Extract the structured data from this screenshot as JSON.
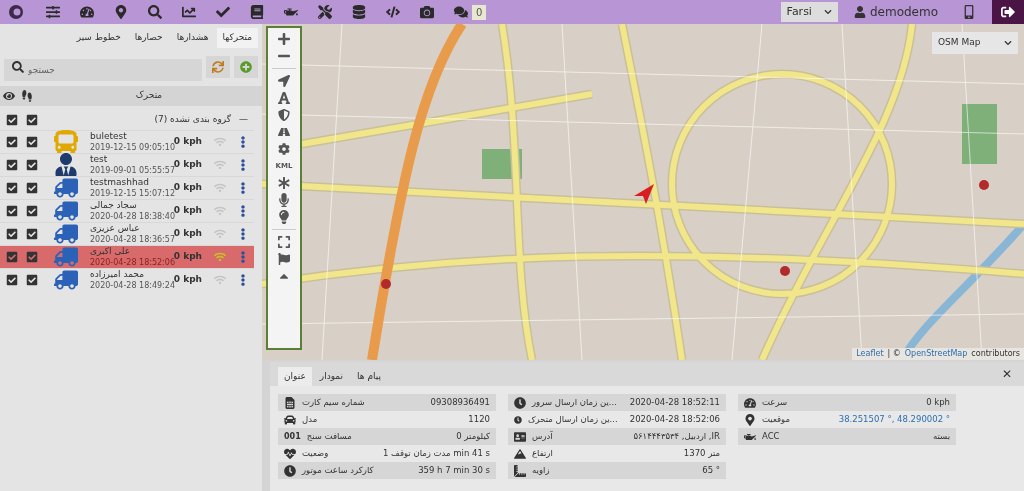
{
  "top_bar": {
    "badge": "0",
    "language": "Farsi",
    "user": "demodemo"
  },
  "sidebar": {
    "tabs": [
      {
        "label": "متحرکها",
        "selected": true
      },
      {
        "label": "هشدارها",
        "selected": false
      },
      {
        "label": "حصارها",
        "selected": false
      },
      {
        "label": "خطوط سیر",
        "selected": false
      }
    ],
    "search": {
      "placeholder": "جستجو"
    },
    "table_header": "متحرک",
    "group": {
      "label": "(7) گروه بندی نشده",
      "collapse": "—",
      "visible": true,
      "tail": true
    },
    "devices": [
      {
        "name": "buletest",
        "time": "2019-12-15 09:05:10",
        "speed": "0 kph",
        "kind": "bus",
        "visible": true,
        "tail": true,
        "selected": false,
        "online": false
      },
      {
        "name": "test",
        "time": "2019-09-01 05:55:57",
        "speed": "0 kph",
        "kind": "person",
        "visible": true,
        "tail": true,
        "selected": false,
        "online": false
      },
      {
        "name": "testmashhad",
        "time": "2019-12-15 15:07:12",
        "speed": "0 kph",
        "kind": "truck",
        "visible": true,
        "tail": true,
        "selected": false,
        "online": false
      },
      {
        "name": "سجاد جمالی",
        "time": "2020-04-28 18:38:40",
        "speed": "0 kph",
        "kind": "truck",
        "visible": true,
        "tail": true,
        "selected": false,
        "online": false
      },
      {
        "name": "عباس عزیزی",
        "time": "2020-04-28 18:36:57",
        "speed": "0 kph",
        "kind": "truck",
        "visible": true,
        "tail": true,
        "selected": false,
        "online": false
      },
      {
        "name": "علی اکبری",
        "time": "2020-04-28 18:52:06",
        "speed": "0 kph",
        "kind": "truck",
        "visible": true,
        "tail": true,
        "selected": true,
        "online": true
      },
      {
        "name": "محمد امیرزاده",
        "time": "2020-04-28 18:49:24",
        "speed": "0 kph",
        "kind": "truck",
        "visible": true,
        "tail": true,
        "selected": false,
        "online": false
      }
    ]
  },
  "map": {
    "layer": "OSM Map",
    "kml_label": "KML",
    "attribution": {
      "link": "Leaflet",
      "separator": "| ©",
      "source": "OpenStreetMap",
      "suffix": "contributors"
    }
  },
  "details": {
    "tabs": [
      {
        "label": "پیام ها",
        "selected": false
      },
      {
        "label": "نمودار",
        "selected": false
      },
      {
        "label": "عنوان",
        "selected": true
      }
    ],
    "close": "✕",
    "columns": [
      [
        {
          "label": "سرعت",
          "value": "0 kph",
          "kind": "text"
        },
        {
          "label": "موقعیت",
          "value": "38.251507 °, 48.290002 °",
          "kind": "link"
        },
        {
          "label": "ACC",
          "value": "بسته",
          "kind": "text"
        }
      ],
      [
        {
          "label": "...ین زمان ارسال سرور",
          "value": "2020-04-28 18:52:11",
          "kind": "text"
        },
        {
          "label": "...ین زمان ارسال متحرک",
          "value": "2020-04-28 18:52:06",
          "kind": "text"
        },
        {
          "label": "آدرس",
          "value": "۵۶۱۴۴۴۳۵۳۴ ,اردبیل ,IR",
          "kind": "text"
        },
        {
          "label": "ارتفاع",
          "value": "متر 1370",
          "kind": "text"
        },
        {
          "label": "زاویه",
          "value": "65 °",
          "kind": "text"
        }
      ],
      [
        {
          "label": "شماره سیم کارت",
          "value": "09308936491",
          "kind": "text"
        },
        {
          "label": "مدل",
          "value": "1120",
          "kind": "text"
        },
        {
          "label": "مسافت سنج",
          "icon_text": "001",
          "value": "کیلومتر 0",
          "kind": "text"
        },
        {
          "label": "وضعیت",
          "value": "1 مدت زمان توقف min 41 s",
          "kind": "text"
        },
        {
          "label": "کارکرد ساعت موتور",
          "value": "359 h 7 min 30 s",
          "kind": "text"
        }
      ]
    ]
  }
}
